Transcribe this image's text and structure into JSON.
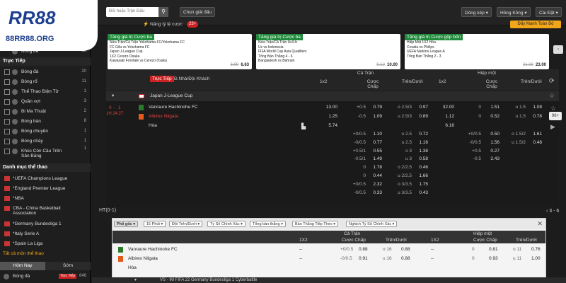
{
  "brand": {
    "logo_text": "RR88",
    "site": "88RR88.ORG"
  },
  "topbar": {
    "search_placeholder": "Đối hoặc Trận Đấu",
    "choose_league": "Chọn giải đấu",
    "odds_type": "Dòng kép",
    "odds_format": "Hồng Kông",
    "settings": "Cài Đặt"
  },
  "sidebar": {
    "first_item": {
      "label": "Bóng đá",
      "count": "23"
    },
    "live_title": "Trực Tiếp",
    "live_items": [
      {
        "label": "Bóng đá",
        "count": "20"
      },
      {
        "label": "Bóng rổ",
        "count": "11"
      },
      {
        "label": "Thể Thao Điện Tử",
        "count": "1"
      },
      {
        "label": "Quần vợt",
        "count": "3"
      },
      {
        "label": "Bi Ma Thuật",
        "count": "2"
      },
      {
        "label": "Bóng bàn",
        "count": "8"
      },
      {
        "label": "Bóng chuyền",
        "count": "1"
      },
      {
        "label": "Bóng chày",
        "count": "1"
      },
      {
        "label": "Khúc Côn Cầu Trên Sân Băng",
        "count": "1"
      }
    ],
    "cat_title": "Danh mục thể thao",
    "cat_items": [
      "*UEFA Champions League",
      "*England Premier League",
      "*NBA",
      "CBA - China Basketball Association",
      "*Germany Bundesliga 1",
      "*Italy Serie A",
      "*Spain La Liga"
    ],
    "all_link": "Tất cả môn thể thao",
    "tabs": [
      "Hôm Nay",
      "Sớm"
    ],
    "bottom_item": {
      "label": "Bóng đá",
      "tag": "Trực Tiếp",
      "count": "846"
    }
  },
  "promo": {
    "label": "Nâng tỷ lệ cược",
    "count": "23+",
    "button": "Đẩy Mạnh Toàn Bộ"
  },
  "cards": [
    {
      "head": "Tăng giá trị Cược ba",
      "lines": [
        "Nửa Trận/Cả Trận Yokohama FC/Yokohama FC",
        "FC Gifu vs Yokohama FC",
        "Japan J-League Cup",
        "1X2 Cerezo Osaka",
        "Kawasaki Frontale vs Cerezo Osaka"
      ],
      "old": "6.99",
      "new": "6.63"
    },
    {
      "head": "Tăng giá trị Cược ba",
      "lines": [
        "Nửa Trận/Cả Trận Uc/Uc",
        "Uc vs Indonesia",
        "FIFA World Cup Asia Qualifiers",
        "Tổng Bàn Thắng 4 - 6",
        "Bangladesh vs Bahrain"
      ],
      "old": "9.12",
      "new": "10.00"
    },
    {
      "head": "Tăng giá trị Cược gộp bốn",
      "lines": [
        "Hiệp Một 1X2 Hòa",
        "Croatia vs Philips",
        "UEFA Nations League A",
        "Tổng Bàn Thắng 2 - 3"
      ],
      "old": "21.08",
      "new": "23.00"
    }
  ],
  "table_header": {
    "live": "Trực Tiếp",
    "home_away": "Đ.Nhà/Đội Khách",
    "fulltime": "Cả Trận",
    "firsthalf": "Hiệp một",
    "cols": [
      "1x2",
      "Cược Chấp",
      "Trên/Dưới",
      "1x2",
      "Cược Chấp",
      "Trên/Dưới"
    ]
  },
  "league": "Japan J-League Cup",
  "match": {
    "score_home": "0",
    "score_away": "1",
    "dash": "-",
    "time": "1H 24:27",
    "home": "Vanraure Hachinohe FC",
    "away": "Albirex Niigata",
    "draw": "Hòa",
    "mkt_btn": "96+"
  },
  "odds_rows": [
    [
      "13.00",
      "+0.5",
      "0.79",
      "o 2.5/3",
      "0.97",
      "32.00",
      "0",
      "1.51",
      "o 1.5",
      "1.08"
    ],
    [
      "1.25",
      "-0.5",
      "1.09",
      "u 2.5/3",
      "0.89",
      "1.12",
      "0",
      "0.52",
      "u 1.5",
      "0.78"
    ],
    [
      "5.74",
      "",
      "",
      "",
      "",
      "6.16",
      "",
      "",
      "",
      ""
    ],
    [
      "",
      "+0/0.5",
      "1.10",
      "o 2.5",
      "0.72",
      "",
      "+0/0.5",
      "0.50",
      "o 1.5/2",
      "1.61"
    ],
    [
      "",
      "-0/0.5",
      "0.77",
      "u 2.5",
      "1.16",
      "",
      "-0/0.5",
      "1.56",
      "u 1.5/2",
      "0.48"
    ],
    [
      "",
      "+0.5/1",
      "0.55",
      "o 3",
      "1.38",
      "",
      "+0.5",
      "0.27",
      "",
      ""
    ],
    [
      "",
      "-0.5/1",
      "1.49",
      "u 3",
      "0.58",
      "",
      "-0.5",
      "2.43",
      "",
      ""
    ],
    [
      "",
      "0",
      "1.78",
      "o 2/2.5",
      "0.46",
      "",
      "",
      "",
      "",
      ""
    ],
    [
      "",
      "0",
      "0.44",
      "u 2/2.5",
      "1.66",
      "",
      "",
      "",
      "",
      ""
    ],
    [
      "",
      "+0/0.5",
      "2.32",
      "o 3/3.5",
      "1.75",
      "",
      "",
      "",
      "",
      ""
    ],
    [
      "",
      "-0/0.5",
      "0.33",
      "u 3/3.5",
      "0.43",
      "",
      "",
      "",
      "",
      ""
    ]
  ],
  "ht": {
    "label": "HT(0-1)",
    "range": "3 - 6"
  },
  "sub": {
    "filters": [
      "Phổ gốc",
      "15 Phút",
      "Đội Trên/Dưới",
      "Tỷ Số Chính Xác",
      "Tổng bàn thắng",
      "Bàn Thắng Tiếp Theo",
      "Nghịch Tỷ Số Chính Xác"
    ],
    "fulltime": "Cả Trận",
    "firsthalf": "Hiệp một",
    "cols": [
      "1X2",
      "Cược Chấp",
      "Trên/Dưới",
      "1X2",
      "Cược Chấp",
      "Trên/Dưới"
    ],
    "home": "Vanraure Hachinohe FC",
    "away": "Albirex Niigata",
    "draw": "Hòa",
    "rows": [
      [
        "--",
        "+0/0.5",
        "0.88",
        "o 16",
        "0.88",
        "--",
        "0",
        "0.81",
        "o 11",
        "0.76"
      ],
      [
        "--",
        "-0/0.5",
        "0.91",
        "u 16",
        "0.88",
        "--",
        "0",
        "0.93",
        "u 11",
        "1.00"
      ]
    ]
  },
  "bottom": "VS - IM FIFA 22 Germany Bundesliga 1 Cyberbattle"
}
